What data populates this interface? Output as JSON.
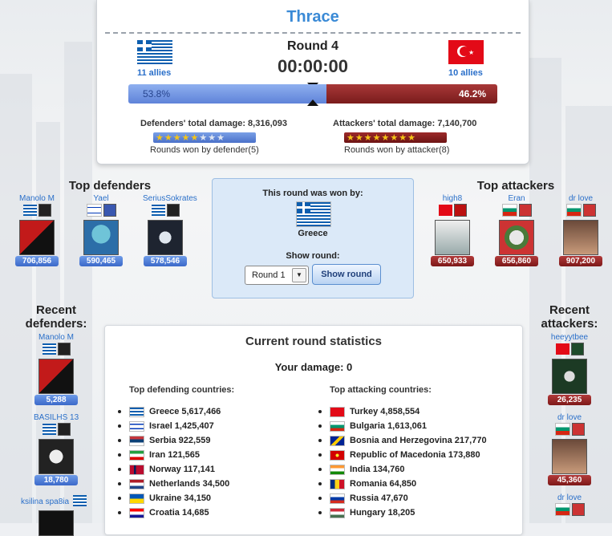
{
  "battle": {
    "region": "Thrace",
    "round_label": "Round 4",
    "timer": "00:00:00",
    "defender": {
      "allies": "11 allies",
      "percent": "53.8%",
      "total_damage": "Defenders' total damage: 8,316,093",
      "rounds_won": "Rounds won by defender(5)"
    },
    "attacker": {
      "allies": "10 allies",
      "percent": "46.2%",
      "total_damage": "Attackers' total damage: 7,140,700",
      "rounds_won": "Rounds won by attacker(8)"
    }
  },
  "top_defenders": {
    "heading": "Top defenders",
    "items": [
      {
        "name": "Manolo M",
        "damage": "706,856"
      },
      {
        "name": "Yael",
        "damage": "590,465"
      },
      {
        "name": "SeriusSokrates",
        "damage": "578,546"
      }
    ]
  },
  "top_attackers": {
    "heading": "Top attackers",
    "items": [
      {
        "name": "high8",
        "damage": "650,933"
      },
      {
        "name": "Eran",
        "damage": "656,860"
      },
      {
        "name": "dr love",
        "damage": "907,200"
      }
    ]
  },
  "round_won": {
    "label": "This round was won by:",
    "country": "Greece",
    "show_round_label": "Show round:",
    "selected_round": "Round 1",
    "show_button": "Show round"
  },
  "recent_defenders": {
    "heading": "Recent defenders:",
    "items": [
      {
        "name": "Manolo M",
        "damage": "5,288"
      },
      {
        "name": "BASILHS 13",
        "damage": "18,780"
      },
      {
        "name": "ksilina spa8ia",
        "damage": ""
      }
    ]
  },
  "recent_attackers": {
    "heading": "Recent attackers:",
    "items": [
      {
        "name": "heeyytbee",
        "damage": "26,235"
      },
      {
        "name": "dr love",
        "damage": "45,360"
      },
      {
        "name": "dr love",
        "damage": ""
      }
    ]
  },
  "stats": {
    "heading": "Current round statistics",
    "your_damage": "Your damage: 0",
    "defending_heading": "Top defending countries:",
    "attacking_heading": "Top attacking countries:",
    "defending": [
      "Greece 5,617,466",
      "Israel 1,425,407",
      "Serbia 922,559",
      "Iran 121,565",
      "Norway 117,141",
      "Netherlands 34,500",
      "Ukraine 34,150",
      "Croatia 14,685"
    ],
    "attacking": [
      "Turkey 4,858,554",
      "Bulgaria 1,613,061",
      "Bosnia and Herzegovina 217,770",
      "Republic of Macedonia 173,880",
      "India 134,760",
      "Romania 64,850",
      "Russia 47,670",
      "Hungary 18,205"
    ]
  },
  "colors": {
    "defender_blue": "#5f83d9",
    "attacker_red": "#7a1c1c",
    "title_blue": "#3a8ad6",
    "star_gold": "#f5c518"
  }
}
